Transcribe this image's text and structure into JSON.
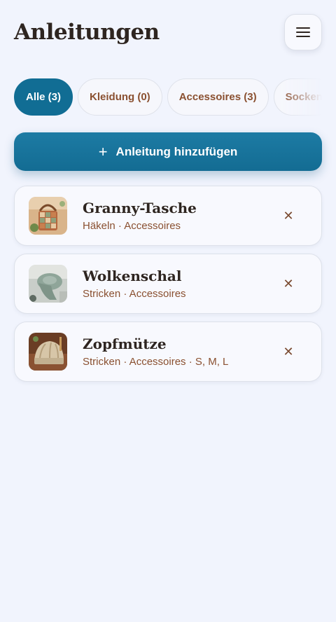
{
  "header": {
    "title": "Anleitungen",
    "menu_icon": "hamburger-icon"
  },
  "filters": [
    {
      "label": "Alle (3)",
      "active": true
    },
    {
      "label": "Kleidung (0)",
      "active": false
    },
    {
      "label": "Accessoires (3)",
      "active": false
    },
    {
      "label": "Socken",
      "active": false
    }
  ],
  "add_button": {
    "icon": "plus-icon",
    "label": "Anleitung hinzufügen"
  },
  "patterns": [
    {
      "title": "Granny-Tasche",
      "meta": "Häkeln · Accessoires",
      "thumb_icon": "bag-photo"
    },
    {
      "title": "Wolkenschal",
      "meta": "Stricken · Accessoires",
      "thumb_icon": "scarf-photo"
    },
    {
      "title": "Zopfmütze",
      "meta": "Stricken · Accessoires · S, M, L",
      "thumb_icon": "hat-photo"
    }
  ],
  "remove_icon": "close-icon",
  "colors": {
    "primary": "#116d94",
    "accent_text": "#8a5030",
    "background": "#f1f4fd"
  }
}
